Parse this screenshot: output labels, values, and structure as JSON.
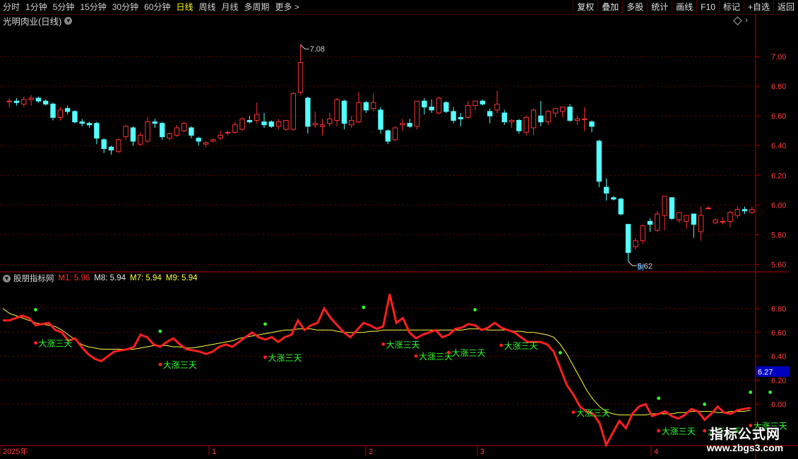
{
  "toolbar": {
    "periods": [
      "分时",
      "1分钟",
      "5分钟",
      "15分钟",
      "30分钟",
      "60分钟",
      "日线",
      "周线",
      "月线",
      "多周期",
      "更多 >"
    ],
    "active_period": "日线",
    "buttons": [
      "复权",
      "叠加",
      "多股",
      "统计",
      "画线",
      "F10",
      "标记",
      "+自选",
      "返回"
    ]
  },
  "stock": {
    "title": "光明肉业(日线)"
  },
  "indicator": {
    "name": "股朋指标网",
    "m1": "M1: 5.96",
    "m8": "M8: 5.94",
    "m7": "M7: 5.94",
    "m9": "M9: 5.94"
  },
  "colors": {
    "up": "#ff3232",
    "down": "#54ffff",
    "grid": "#6e0000",
    "axis": "#b40000",
    "yellow": "#ffff40",
    "green": "#30ff30",
    "signal": "#ff2020"
  },
  "chart_data": [
    {
      "type": "candlestick",
      "title": "光明肉业(日线)",
      "ylim": [
        5.55,
        7.2
      ],
      "y_ticks": [
        "7.00",
        "6.80",
        "6.60",
        "6.40",
        "6.20",
        "6.00",
        "5.80",
        "5.60"
      ],
      "annotations": {
        "high_label": "7.08",
        "low_label": "5.62",
        "badge": "财"
      },
      "ohlc": [
        [
          6.7,
          6.72,
          6.66,
          6.7
        ],
        [
          6.7,
          6.72,
          6.67,
          6.69
        ],
        [
          6.68,
          6.73,
          6.66,
          6.71
        ],
        [
          6.71,
          6.74,
          6.67,
          6.72
        ],
        [
          6.72,
          6.73,
          6.69,
          6.7
        ],
        [
          6.7,
          6.71,
          6.67,
          6.68
        ],
        [
          6.68,
          6.69,
          6.57,
          6.59
        ],
        [
          6.59,
          6.66,
          6.57,
          6.64
        ],
        [
          6.65,
          6.67,
          6.61,
          6.63
        ],
        [
          6.63,
          6.64,
          6.55,
          6.56
        ],
        [
          6.56,
          6.58,
          6.53,
          6.55
        ],
        [
          6.55,
          6.56,
          6.52,
          6.54
        ],
        [
          6.55,
          6.56,
          6.41,
          6.45
        ],
        [
          6.44,
          6.45,
          6.35,
          6.38
        ],
        [
          6.39,
          6.4,
          6.34,
          6.37
        ],
        [
          6.36,
          6.45,
          6.35,
          6.44
        ],
        [
          6.46,
          6.54,
          6.44,
          6.53
        ],
        [
          6.52,
          6.53,
          6.4,
          6.43
        ],
        [
          6.41,
          6.49,
          6.4,
          6.47
        ],
        [
          6.43,
          6.59,
          6.42,
          6.56
        ],
        [
          6.56,
          6.58,
          6.52,
          6.55
        ],
        [
          6.55,
          6.56,
          6.44,
          6.46
        ],
        [
          6.45,
          6.49,
          6.44,
          6.48
        ],
        [
          6.47,
          6.54,
          6.46,
          6.52
        ],
        [
          6.5,
          6.56,
          6.49,
          6.55
        ],
        [
          6.52,
          6.53,
          6.45,
          6.47
        ],
        [
          6.45,
          6.46,
          6.4,
          6.43
        ],
        [
          6.41,
          6.43,
          6.39,
          6.42
        ],
        [
          6.43,
          6.45,
          6.42,
          6.44
        ],
        [
          6.45,
          6.5,
          6.44,
          6.47
        ],
        [
          6.49,
          6.5,
          6.47,
          6.49
        ],
        [
          6.49,
          6.56,
          6.48,
          6.54
        ],
        [
          6.51,
          6.59,
          6.5,
          6.58
        ],
        [
          6.57,
          6.6,
          6.55,
          6.56
        ],
        [
          6.57,
          6.69,
          6.55,
          6.61
        ],
        [
          6.56,
          6.62,
          6.52,
          6.54
        ],
        [
          6.56,
          6.57,
          6.52,
          6.53
        ],
        [
          6.53,
          6.58,
          6.51,
          6.56
        ],
        [
          6.51,
          6.57,
          6.5,
          6.57
        ],
        [
          6.51,
          6.76,
          6.5,
          6.75
        ],
        [
          6.76,
          7.08,
          6.74,
          6.96
        ],
        [
          6.72,
          6.73,
          6.48,
          6.53
        ],
        [
          6.54,
          6.63,
          6.52,
          6.55
        ],
        [
          6.53,
          6.58,
          6.47,
          6.54
        ],
        [
          6.55,
          6.62,
          6.53,
          6.58
        ],
        [
          6.57,
          6.72,
          6.53,
          6.71
        ],
        [
          6.7,
          6.71,
          6.51,
          6.55
        ],
        [
          6.54,
          6.6,
          6.52,
          6.57
        ],
        [
          6.56,
          6.76,
          6.55,
          6.69
        ],
        [
          6.69,
          6.7,
          6.62,
          6.64
        ],
        [
          6.65,
          6.75,
          6.63,
          6.69
        ],
        [
          6.64,
          6.66,
          6.48,
          6.51
        ],
        [
          6.5,
          6.51,
          6.41,
          6.43
        ],
        [
          6.44,
          6.53,
          6.43,
          6.52
        ],
        [
          6.54,
          6.58,
          6.5,
          6.55
        ],
        [
          6.55,
          6.58,
          6.52,
          6.53
        ],
        [
          6.53,
          6.7,
          6.51,
          6.7
        ],
        [
          6.7,
          6.72,
          6.61,
          6.66
        ],
        [
          6.66,
          6.71,
          6.62,
          6.64
        ],
        [
          6.62,
          6.73,
          6.61,
          6.72
        ],
        [
          6.69,
          6.7,
          6.62,
          6.63
        ],
        [
          6.63,
          6.66,
          6.55,
          6.57
        ],
        [
          6.59,
          6.62,
          6.53,
          6.58
        ],
        [
          6.59,
          6.7,
          6.58,
          6.67
        ],
        [
          6.67,
          6.7,
          6.64,
          6.7
        ],
        [
          6.7,
          6.71,
          6.67,
          6.68
        ],
        [
          6.63,
          6.65,
          6.55,
          6.6
        ],
        [
          6.64,
          6.77,
          6.62,
          6.68
        ],
        [
          6.62,
          6.64,
          6.54,
          6.56
        ],
        [
          6.56,
          6.58,
          6.52,
          6.57
        ],
        [
          6.57,
          6.58,
          6.48,
          6.5
        ],
        [
          6.49,
          6.6,
          6.47,
          6.59
        ],
        [
          6.52,
          6.65,
          6.47,
          6.64
        ],
        [
          6.6,
          6.7,
          6.53,
          6.56
        ],
        [
          6.56,
          6.64,
          6.54,
          6.63
        ],
        [
          6.62,
          6.65,
          6.59,
          6.65
        ],
        [
          6.63,
          6.66,
          6.59,
          6.66
        ],
        [
          6.66,
          6.68,
          6.56,
          6.57
        ],
        [
          6.57,
          6.6,
          6.54,
          6.58
        ],
        [
          6.58,
          6.66,
          6.5,
          6.58
        ],
        [
          6.56,
          6.57,
          6.49,
          6.53
        ],
        [
          6.43,
          6.44,
          6.12,
          6.16
        ],
        [
          6.12,
          6.18,
          6.03,
          6.08
        ],
        [
          6.05,
          6.06,
          6.03,
          6.04
        ],
        [
          6.04,
          6.05,
          5.93,
          5.94
        ],
        [
          5.87,
          5.87,
          5.62,
          5.68
        ],
        [
          5.72,
          5.78,
          5.7,
          5.76
        ],
        [
          5.76,
          5.87,
          5.74,
          5.86
        ],
        [
          5.89,
          5.91,
          5.82,
          5.87
        ],
        [
          5.83,
          5.96,
          5.82,
          5.94
        ],
        [
          5.93,
          6.06,
          5.83,
          6.06
        ],
        [
          6.05,
          6.05,
          5.9,
          5.91
        ],
        [
          5.9,
          5.95,
          5.88,
          5.95
        ],
        [
          5.89,
          5.93,
          5.84,
          5.93
        ],
        [
          5.94,
          5.94,
          5.78,
          5.87
        ],
        [
          5.82,
          5.99,
          5.76,
          5.93
        ],
        [
          5.98,
          5.99,
          5.97,
          5.98
        ],
        [
          5.88,
          5.91,
          5.87,
          5.9
        ],
        [
          5.89,
          5.92,
          5.87,
          5.89
        ],
        [
          5.89,
          5.96,
          5.85,
          5.95
        ],
        [
          5.93,
          5.99,
          5.91,
          5.97
        ],
        [
          5.97,
          5.99,
          5.94,
          5.96
        ],
        [
          5.95,
          5.99,
          5.94,
          5.97
        ]
      ]
    },
    {
      "type": "line",
      "title": "股朋指标网",
      "ylim": [
        5.66,
        7.0
      ],
      "y_ticks": [
        "6.80",
        "6.60",
        "6.40",
        "6.20",
        "6.00"
      ],
      "current_value_label": "6.27",
      "x_labels": [
        "2025年",
        "1",
        "2",
        "3",
        "4"
      ],
      "series": [
        {
          "name": "M1",
          "values": [
            6.7,
            6.7,
            6.72,
            6.74,
            6.72,
            6.66,
            6.67,
            6.68,
            6.62,
            6.6,
            6.53,
            6.55,
            6.48,
            6.42,
            6.38,
            6.36,
            6.4,
            6.44,
            6.45,
            6.46,
            6.48,
            6.58,
            6.56,
            6.5,
            6.48,
            6.52,
            6.55,
            6.5,
            6.46,
            6.45,
            6.44,
            6.42,
            6.44,
            6.48,
            6.5,
            6.48,
            6.52,
            6.56,
            6.6,
            6.56,
            6.54,
            6.56,
            6.52,
            6.56,
            6.58,
            6.7,
            6.62,
            6.66,
            6.68,
            6.8,
            6.72,
            6.66,
            6.6,
            6.56,
            6.62,
            6.68,
            6.66,
            6.63,
            6.65,
            6.92,
            6.68,
            6.72,
            6.6,
            6.55,
            6.58,
            6.6,
            6.62,
            6.56,
            6.58,
            6.63,
            6.64,
            6.67,
            6.66,
            6.62,
            6.64,
            6.68,
            6.64,
            6.62,
            6.6,
            6.56,
            6.52,
            6.52,
            6.52,
            6.5,
            6.44,
            6.3,
            6.16,
            6.08,
            5.98,
            5.94,
            5.92,
            5.84,
            5.66,
            5.76,
            5.86,
            5.8,
            5.92,
            5.98,
            6.0,
            5.9,
            5.92,
            5.94,
            5.9,
            5.88,
            5.91,
            5.96,
            5.94,
            5.87,
            5.92,
            5.98,
            5.93,
            5.92,
            5.95,
            5.96,
            5.97
          ]
        },
        {
          "name": "M8",
          "values": [
            6.8,
            6.76,
            6.74,
            6.72,
            6.7,
            6.68,
            6.67,
            6.66,
            6.65,
            6.62,
            6.58,
            6.54,
            6.5,
            6.48,
            6.47,
            6.46,
            6.46,
            6.46,
            6.46,
            6.46,
            6.46,
            6.47,
            6.48,
            6.49,
            6.49,
            6.49,
            6.48,
            6.48,
            6.47,
            6.47,
            6.48,
            6.49,
            6.5,
            6.51,
            6.52,
            6.53,
            6.55,
            6.56,
            6.57,
            6.58,
            6.59,
            6.6,
            6.61,
            6.62,
            6.62,
            6.63,
            6.63,
            6.63,
            6.62,
            6.62,
            6.62,
            6.61,
            6.6,
            6.6,
            6.6,
            6.6,
            6.61,
            6.61,
            6.62,
            6.62,
            6.62,
            6.62,
            6.62,
            6.62,
            6.62,
            6.62,
            6.62,
            6.62,
            6.62,
            6.62,
            6.62,
            6.63,
            6.63,
            6.63,
            6.62,
            6.62,
            6.62,
            6.62,
            6.61,
            6.61,
            6.6,
            6.6,
            6.59,
            6.58,
            6.56,
            6.5,
            6.42,
            6.32,
            6.22,
            6.12,
            6.04,
            5.98,
            5.94,
            5.92,
            5.91,
            5.91,
            5.91,
            5.91,
            5.91,
            5.92,
            5.92,
            5.92,
            5.92,
            5.93,
            5.93,
            5.94,
            5.94,
            5.94,
            5.94,
            5.93,
            5.93,
            5.94,
            5.94,
            5.94,
            5.95
          ]
        }
      ],
      "signal_label": "大涨三天",
      "signal_indices": [
        5,
        24,
        40,
        58,
        63,
        68,
        76,
        87,
        100,
        107,
        114
      ],
      "green_dots": [
        5,
        24,
        40,
        55,
        72,
        85,
        100,
        107,
        114,
        117,
        121,
        124,
        126,
        128
      ]
    }
  ]
}
